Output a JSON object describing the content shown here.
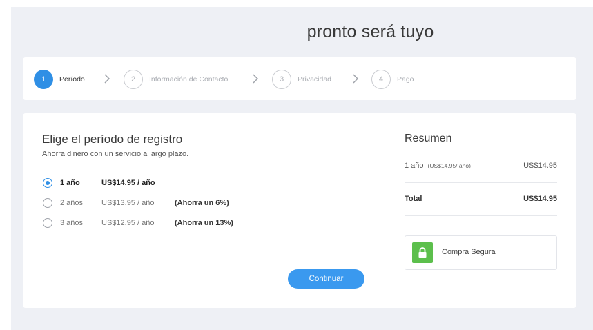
{
  "header": {
    "title": "pronto será tuyo"
  },
  "steps": [
    {
      "number": "1",
      "label": "Período"
    },
    {
      "number": "2",
      "label": "Información de Contacto"
    },
    {
      "number": "3",
      "label": "Privacidad"
    },
    {
      "number": "4",
      "label": "Pago"
    }
  ],
  "period": {
    "heading": "Elige el período de registro",
    "subheading": "Ahorra dinero con un servicio a largo plazo.",
    "options": [
      {
        "years": "1 año",
        "price": "US$14.95 / año",
        "saving": "",
        "selected": true
      },
      {
        "years": "2 años",
        "price": "US$13.95 / año",
        "saving": "(Ahorra un 6%)",
        "selected": false
      },
      {
        "years": "3 años",
        "price": "US$12.95 / año",
        "saving": "(Ahorra un 13%)",
        "selected": false
      }
    ],
    "continue_label": "Continuar"
  },
  "summary": {
    "heading": "Resumen",
    "item_label": "1 año",
    "item_detail": "(US$14.95/ año)",
    "item_price": "US$14.95",
    "total_label": "Total",
    "total_price": "US$14.95",
    "secure_label": "Compra Segura"
  },
  "colors": {
    "accent": "#2f8fe5",
    "secure": "#5cbf4c"
  }
}
